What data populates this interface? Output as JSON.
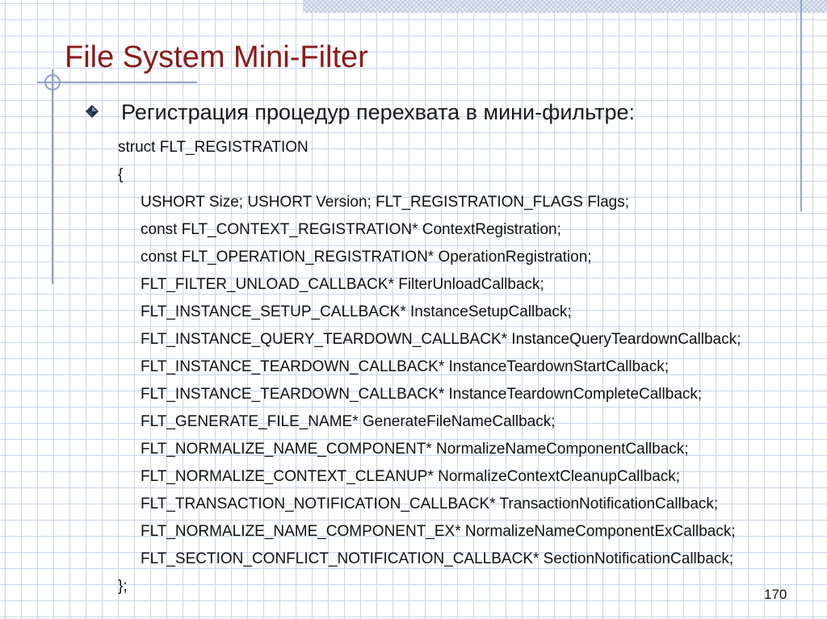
{
  "slide": {
    "title": "File System Mini-Filter",
    "bullet": "Регистрация процедур перехвата в мини-фильтре:",
    "code": {
      "header": "struct FLT_REGISTRATION",
      "open_brace": "{",
      "fields": [
        "USHORT Size; USHORT Version; FLT_REGISTRATION_FLAGS Flags;",
        "const FLT_CONTEXT_REGISTRATION* ContextRegistration;",
        "const FLT_OPERATION_REGISTRATION* OperationRegistration;",
        "FLT_FILTER_UNLOAD_CALLBACK* FilterUnloadCallback;",
        "FLT_INSTANCE_SETUP_CALLBACK* InstanceSetupCallback;",
        "FLT_INSTANCE_QUERY_TEARDOWN_CALLBACK* InstanceQueryTeardownCallback;",
        "FLT_INSTANCE_TEARDOWN_CALLBACK* InstanceTeardownStartCallback;",
        "FLT_INSTANCE_TEARDOWN_CALLBACK* InstanceTeardownCompleteCallback;",
        "FLT_GENERATE_FILE_NAME* GenerateFileNameCallback;",
        "FLT_NORMALIZE_NAME_COMPONENT* NormalizeNameComponentCallback;",
        "FLT_NORMALIZE_CONTEXT_CLEANUP* NormalizeContextCleanupCallback;",
        "FLT_TRANSACTION_NOTIFICATION_CALLBACK* TransactionNotificationCallback;",
        "FLT_NORMALIZE_NAME_COMPONENT_EX* NormalizeNameComponentExCallback;",
        "FLT_SECTION_CONFLICT_NOTIFICATION_CALLBACK* SectionNotificationCallback;"
      ],
      "close": "};"
    },
    "page_number": "170"
  },
  "colors": {
    "title": "#8b1a1a",
    "grid": "#c9d5e6",
    "decor": "#8ea3c6",
    "text": "#111111"
  },
  "icons": {
    "bullet": "diamond-bullet-icon"
  }
}
